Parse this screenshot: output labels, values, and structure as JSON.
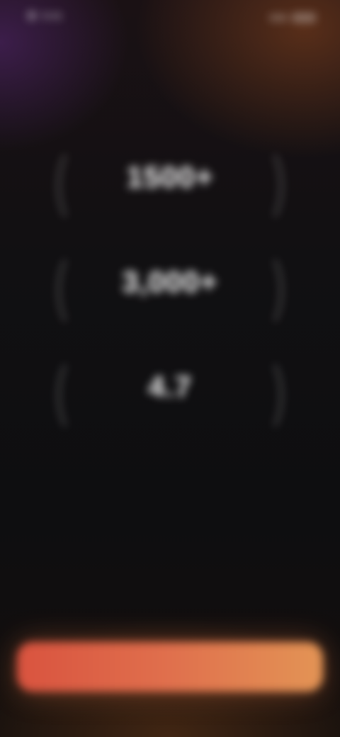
{
  "status_bar": {
    "time": "9:41"
  },
  "stats": [
    {
      "value": "1500+",
      "label": ""
    },
    {
      "value": "3,000+",
      "label": ""
    },
    {
      "value": "4.7",
      "label": ""
    }
  ],
  "message": "",
  "secondary_link": "",
  "cta": {
    "label": ""
  },
  "colors": {
    "accent_start": "#d9533f",
    "accent_end": "#e39455",
    "background": "#0e0e10"
  }
}
